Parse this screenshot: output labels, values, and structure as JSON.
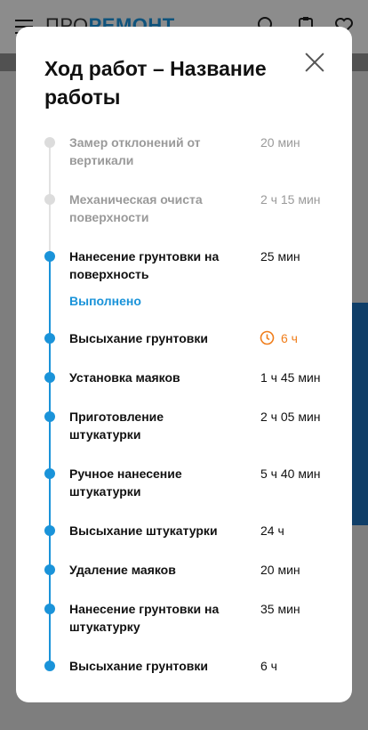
{
  "header": {
    "logo_pro": "ПРО",
    "logo_remont": "РЕМОНТ"
  },
  "modal": {
    "title": "Ход работ – Название работы",
    "status_done": "Выполнено"
  },
  "steps": [
    {
      "name": "Замер отклонений от вертикали",
      "time": "20 мин",
      "state": "done"
    },
    {
      "name": "Механическая очиста поверхности",
      "time": "2 ч 15 мин",
      "state": "done"
    },
    {
      "name": "Нанесение грунтовки на поверхность",
      "time": "25 мин",
      "state": "active"
    },
    {
      "name": "Высыхание грунтовки",
      "time": "6 ч",
      "state": "warn"
    },
    {
      "name": "Установка маяков",
      "time": "1 ч 45 мин",
      "state": "active"
    },
    {
      "name": "Приготовление штукатурки",
      "time": "2 ч 05 мин",
      "state": "active"
    },
    {
      "name": "Ручное нанесение штукатурки",
      "time": "5 ч 40 мин",
      "state": "active"
    },
    {
      "name": "Высыхание штукатурки",
      "time": "24 ч",
      "state": "active"
    },
    {
      "name": "Удаление маяков",
      "time": "20 мин",
      "state": "active"
    },
    {
      "name": "Нанесение грунтовки на штукатурку",
      "time": "35 мин",
      "state": "active"
    },
    {
      "name": "Высыхание грунтовки",
      "time": "6 ч",
      "state": "active"
    }
  ],
  "colors": {
    "accent": "#1a93d9",
    "warning": "#f07d1a",
    "inactive": "#9a9a9a"
  }
}
